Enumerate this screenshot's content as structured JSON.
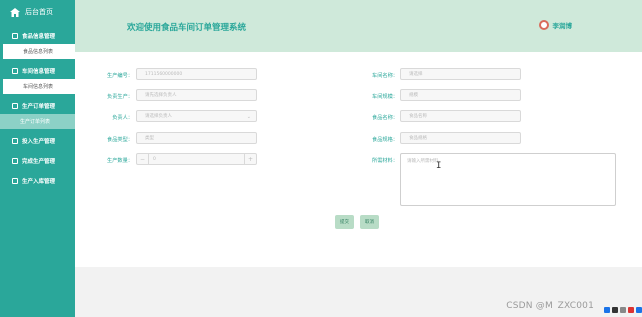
{
  "sidebar": {
    "home": "后台首页",
    "items": [
      {
        "type": "group",
        "label": "食品信息管理"
      },
      {
        "type": "sub",
        "label": "食品信息列表",
        "state": "white"
      },
      {
        "type": "group",
        "label": "车间信息管理"
      },
      {
        "type": "sub",
        "label": "车间信息列表",
        "state": "white"
      },
      {
        "type": "group",
        "label": "生产订单管理"
      },
      {
        "type": "sub",
        "label": "生产订单列表",
        "state": "active"
      },
      {
        "type": "group",
        "label": "投入生产管理"
      },
      {
        "type": "group",
        "label": "完成生产管理"
      },
      {
        "type": "group",
        "label": "生产入库管理"
      }
    ]
  },
  "header": {
    "title": "欢迎使用食品车间订单管理系统",
    "user": "李润博"
  },
  "form": {
    "production_no": {
      "label": "生产编号：",
      "placeholder": "1711560000000"
    },
    "workshop_name": {
      "label": "车间名称：",
      "placeholder": "请选择"
    },
    "responsible_producer": {
      "label": "负责生产：",
      "placeholder": "请先选择负责人"
    },
    "workshop_size": {
      "label": "车间规模：",
      "placeholder": "规模"
    },
    "responsible_person": {
      "label": "负责人：",
      "placeholder": "请选择负责人"
    },
    "food_name": {
      "label": "食品名称：",
      "placeholder": "食品名称"
    },
    "food_type": {
      "label": "食品类型：",
      "placeholder": "类型"
    },
    "food_spec": {
      "label": "食品规格：",
      "placeholder": "食品规格"
    },
    "production_qty": {
      "label": "生产数量：",
      "value": "0",
      "minus": "−",
      "plus": "+"
    },
    "materials": {
      "label": "所需材料：",
      "placeholder": "请输入所需材料"
    }
  },
  "actions": {
    "submit": "提交",
    "cancel": "取消"
  },
  "watermark": "CSDN @M ZXC001",
  "colors": {
    "sidebar": "#2aa79a",
    "header": "#cfe9da",
    "accent": "#2aa79a",
    "button": "#b8dcc6"
  }
}
